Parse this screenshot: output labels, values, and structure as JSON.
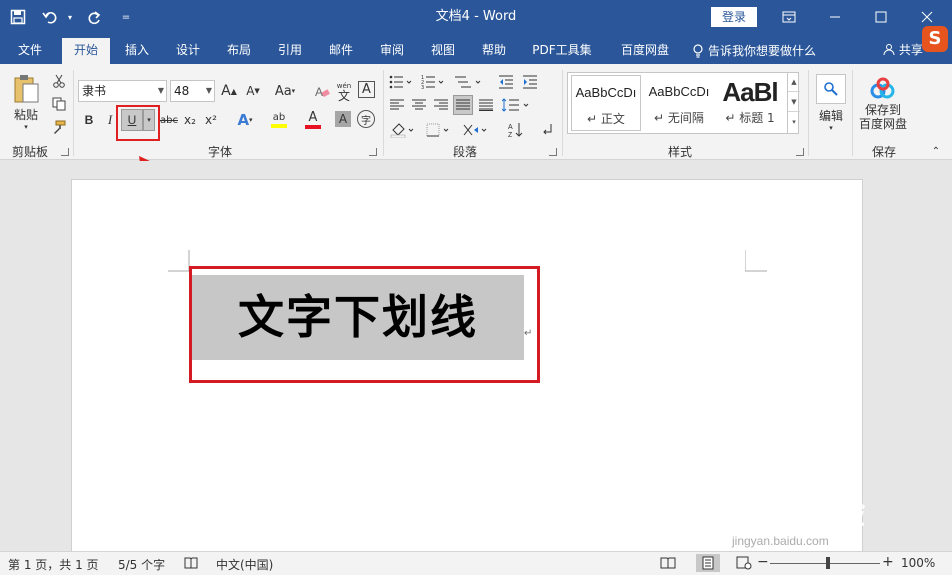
{
  "window": {
    "title": "文档4  -  Word",
    "login_label": "登录"
  },
  "qat": {
    "save_icon": "save-icon",
    "undo_icon": "undo-icon",
    "redo_icon": "redo-icon",
    "customize_icon": "customize-qat-icon"
  },
  "tabs": [
    {
      "label": "文件"
    },
    {
      "label": "开始"
    },
    {
      "label": "插入"
    },
    {
      "label": "设计"
    },
    {
      "label": "布局"
    },
    {
      "label": "引用"
    },
    {
      "label": "邮件"
    },
    {
      "label": "审阅"
    },
    {
      "label": "视图"
    },
    {
      "label": "帮助"
    },
    {
      "label": "PDF工具集"
    },
    {
      "label": "百度网盘"
    }
  ],
  "tell_me": "告诉我你想要做什么",
  "share": "共享",
  "sogou": "S",
  "ribbon": {
    "clipboard": {
      "paste": "粘贴",
      "label": "剪贴板"
    },
    "font": {
      "font_name": "隶书",
      "font_size": "48",
      "grow": "A",
      "shrink": "A",
      "case": "Aa",
      "phonetic_top": "wén",
      "phonetic_bottom": "文",
      "border_char": "A",
      "bold": "B",
      "italic": "I",
      "underline": "U",
      "strike": "abc",
      "subscript": "x₂",
      "superscript": "x²",
      "effects": "A",
      "highlight": "ab",
      "color": "A",
      "shading": "A",
      "circle": "字",
      "label": "字体"
    },
    "paragraph": {
      "label": "段落"
    },
    "styles": {
      "items": [
        {
          "preview": "AaBbCcDı",
          "name": "正文"
        },
        {
          "preview": "AaBbCcDı",
          "name": "无间隔"
        },
        {
          "preview": "AaBl",
          "name": "标题 1"
        }
      ],
      "label": "样式"
    },
    "editing": {
      "label": "编辑"
    },
    "save": {
      "line1": "保存到",
      "line2": "百度网盘",
      "label": "保存"
    }
  },
  "document": {
    "text": "文字下划线",
    "para_mark": "↵"
  },
  "watermark": {
    "big": "Bai  经验",
    "small": "jingyan.baidu.com"
  },
  "statusbar": {
    "page": "第 1 页，共 1 页",
    "words": "5/5 个字",
    "language": "中文(中国)",
    "zoom": "100%"
  }
}
